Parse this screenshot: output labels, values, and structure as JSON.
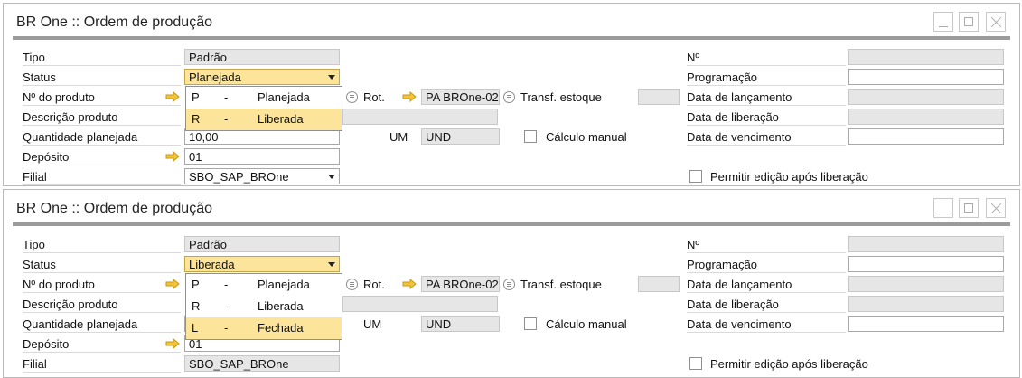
{
  "windows": [
    {
      "title": "BR One :: Ordem de produção",
      "labels": {
        "tipo": "Tipo",
        "status": "Status",
        "num_produto": "Nº do produto",
        "descricao": "Descrição produto",
        "quantidade": "Quantidade planejada",
        "deposito": "Depósito",
        "filial": "Filial",
        "rot": "Rot.",
        "transf": "Transf. estoque",
        "um": "UM",
        "calculo": "Cálculo manual",
        "numero": "Nº",
        "programacao": "Programação",
        "data_lancamento": "Data de lançamento",
        "data_liberacao": "Data de liberação",
        "data_vencimento": "Data de vencimento",
        "permitir": "Permitir edição após liberação"
      },
      "values": {
        "tipo": "Padrão",
        "status": "Planejada",
        "quantidade": "10,00",
        "deposito": "01",
        "filial": "SBO_SAP_BROne",
        "rot": "PA BROne-02",
        "um": "UND"
      },
      "dropdown": [
        {
          "code": "P",
          "dash": "-",
          "desc": "Planejada",
          "highlighted": false
        },
        {
          "code": "R",
          "dash": "-",
          "desc": "Liberada",
          "highlighted": true
        }
      ]
    },
    {
      "title": "BR One :: Ordem de produção",
      "labels": {
        "tipo": "Tipo",
        "status": "Status",
        "num_produto": "Nº do produto",
        "descricao": "Descrição produto",
        "quantidade": "Quantidade planejada",
        "deposito": "Depósito",
        "filial": "Filial",
        "rot": "Rot.",
        "transf": "Transf. estoque",
        "um": "UM",
        "calculo": "Cálculo manual",
        "numero": "Nº",
        "programacao": "Programação",
        "data_lancamento": "Data de lançamento",
        "data_liberacao": "Data de liberação",
        "data_vencimento": "Data de vencimento",
        "permitir": "Permitir edição após liberação"
      },
      "values": {
        "tipo": "Padrão",
        "status": "Liberada",
        "quantidade": "",
        "deposito": "01",
        "filial": "SBO_SAP_BROne",
        "rot": "PA BROne-02",
        "um": "UND"
      },
      "dropdown": [
        {
          "code": "P",
          "dash": "-",
          "desc": "Planejada",
          "highlighted": false
        },
        {
          "code": "R",
          "dash": "-",
          "desc": "Liberada",
          "highlighted": false
        },
        {
          "code": "L",
          "dash": "-",
          "desc": "Fechada",
          "highlighted": true
        }
      ]
    }
  ],
  "colors": {
    "highlight": "#fce59a",
    "readonly": "#e6e6e6",
    "arrow": "#f2c43b"
  }
}
